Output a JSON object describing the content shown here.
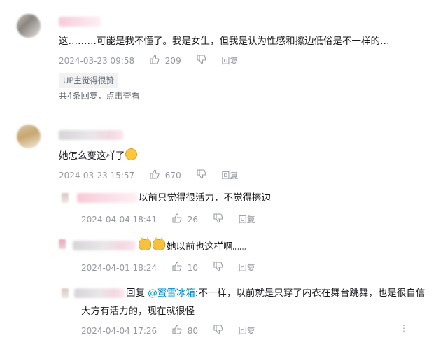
{
  "comments": [
    {
      "text": "这………可能是我不懂了。我是女生，但我是认为性感和擦边低俗是不一样的…",
      "date": "2024-03-23 09:58",
      "likes": "209",
      "reply_label": "回复",
      "badge": "UP主觉得很赞",
      "replies_summary": "共4条回复，点击查看"
    },
    {
      "text": "她怎么变这样了",
      "date": "2024-03-23 15:57",
      "likes": "670",
      "reply_label": "回复",
      "replies": [
        {
          "text": "以前只觉得很活力，不觉得擦边",
          "date": "2024-04-04 18:41",
          "likes": "26",
          "reply_label": "回复"
        },
        {
          "text": "她以前也这样啊。。。",
          "date": "2024-04-01 18:24",
          "likes": "10",
          "reply_label": "回复"
        },
        {
          "prefix": "回复",
          "mention": "@蜜雪冰箱",
          "text_line1": ":不一样，以前就是只穿了内衣在舞台跳舞，也是很自信",
          "text_line2": "大方有活力的，现在就很怪",
          "date": "2024-04-04 17:26",
          "likes": "80",
          "reply_label": "回复"
        }
      ]
    }
  ],
  "icons": {
    "like": "thumb-up-icon",
    "dislike": "thumb-down-icon",
    "more": "more-dots-icon"
  }
}
